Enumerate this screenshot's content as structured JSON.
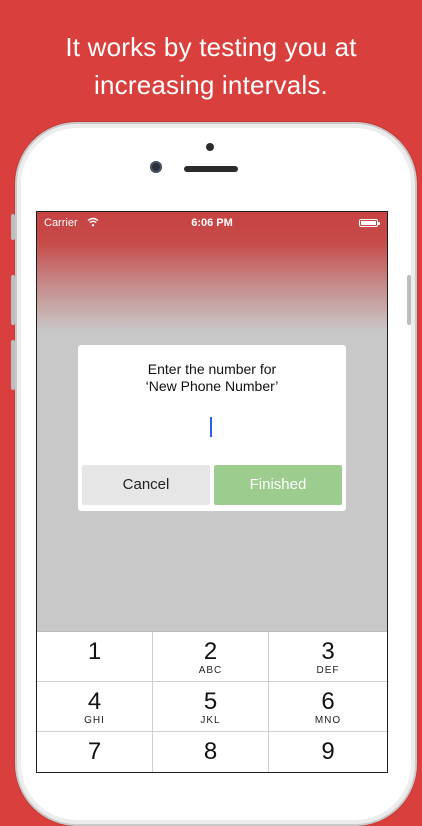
{
  "headline": {
    "line1": "It works by testing you at",
    "line2": "increasing intervals."
  },
  "status_bar": {
    "carrier": "Carrier",
    "time": "6:06 PM",
    "wifi_icon": "wifi-icon",
    "battery_icon": "battery-icon"
  },
  "dialog": {
    "title_line1": "Enter the number for",
    "title_line2": "‘New Phone Number’",
    "cancel_label": "Cancel",
    "finished_label": "Finished"
  },
  "keypad": {
    "keys": [
      {
        "num": "1",
        "letters": ""
      },
      {
        "num": "2",
        "letters": "ABC"
      },
      {
        "num": "3",
        "letters": "DEF"
      },
      {
        "num": "4",
        "letters": "GHI"
      },
      {
        "num": "5",
        "letters": "JKL"
      },
      {
        "num": "6",
        "letters": "MNO"
      },
      {
        "num": "7",
        "letters": ""
      },
      {
        "num": "8",
        "letters": ""
      },
      {
        "num": "9",
        "letters": ""
      }
    ]
  },
  "colors": {
    "background": "#d93f3c",
    "finished_button": "#9ccc8e",
    "cancel_button": "#e6e6e6",
    "cursor": "#2a5ee8"
  }
}
